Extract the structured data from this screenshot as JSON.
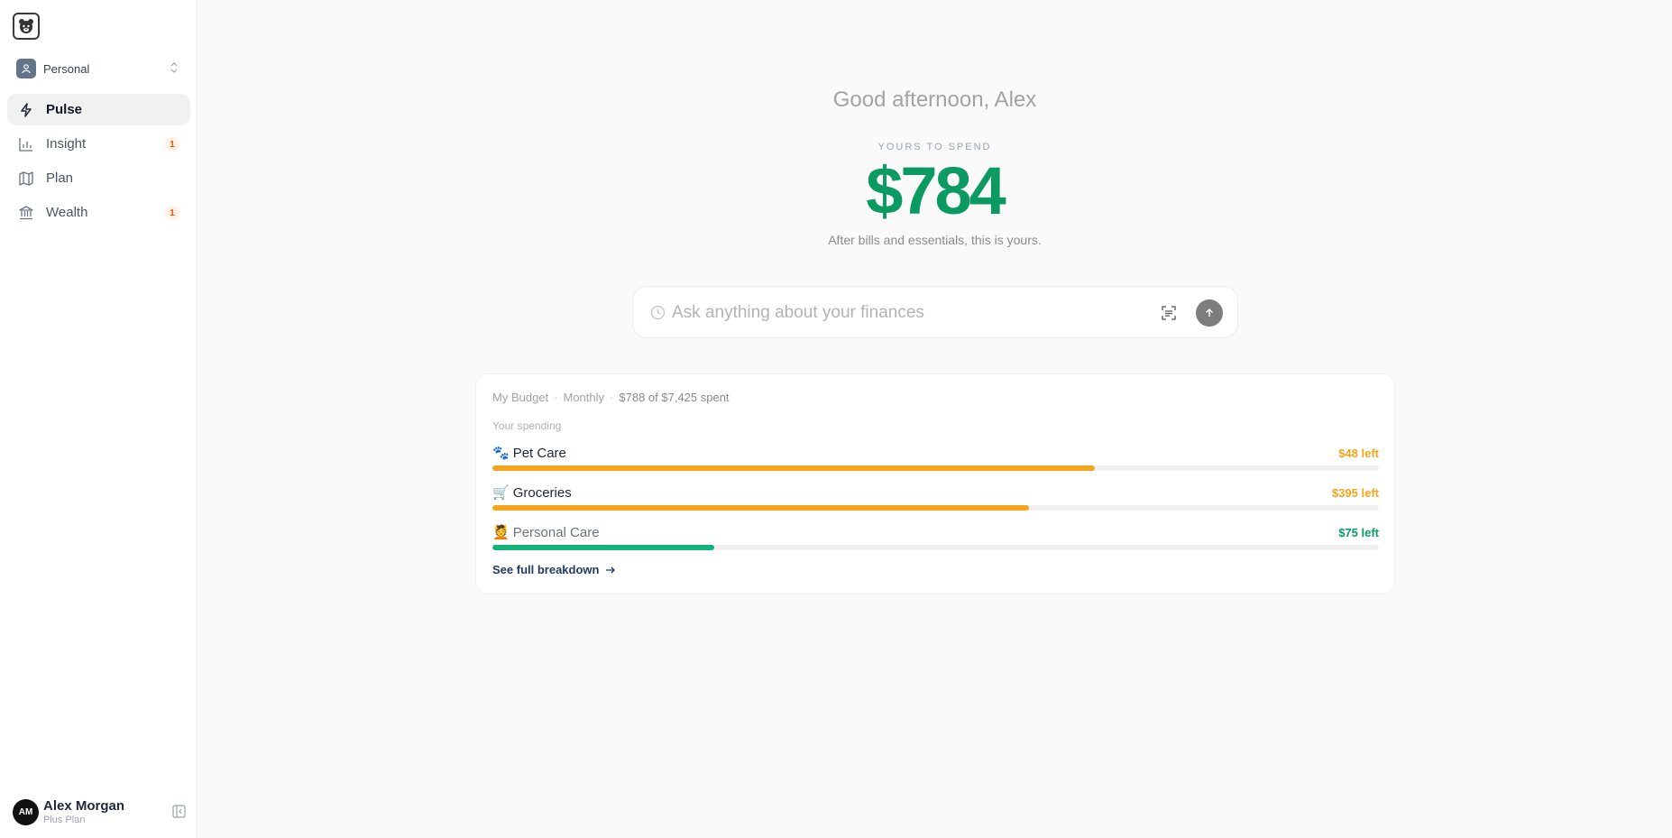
{
  "sidebar": {
    "workspace": {
      "label": "Personal"
    },
    "items": [
      {
        "label": "Pulse",
        "active": true,
        "icon": "bolt-icon"
      },
      {
        "label": "Insight",
        "badge": "1",
        "icon": "bar-chart-icon"
      },
      {
        "label": "Plan",
        "icon": "map-icon"
      },
      {
        "label": "Wealth",
        "badge": "1",
        "icon": "bank-icon"
      }
    ],
    "user": {
      "initials": "AM",
      "name": "Alex Morgan",
      "plan": "Plus Plan"
    }
  },
  "main": {
    "greeting": "Good afternoon, Alex",
    "spend_label": "YOURS TO SPEND",
    "spend_amount": "$784",
    "spend_sub": "After bills and essentials, this is yours.",
    "ask_placeholder": "Ask anything about your finances"
  },
  "budget": {
    "name": "My Budget",
    "period": "Monthly",
    "spent_summary": "$788 of $7,425 spent",
    "section_label": "Your spending",
    "categories": [
      {
        "emoji": "🐾",
        "name": "Pet Care",
        "left": "$48 left",
        "progress": 0.68,
        "color": "#f4a41d"
      },
      {
        "emoji": "🛒",
        "name": "Groceries",
        "left": "$395 left",
        "progress": 0.605,
        "color": "#f4a41d"
      },
      {
        "emoji": "💆",
        "name": "Personal Care",
        "left": "$75 left",
        "progress": 0.25,
        "color": "#12b47a"
      }
    ],
    "see_more": "See full breakdown"
  },
  "colors": {
    "accent_green": "#0c9a63",
    "warning_orange": "#f4a41d"
  }
}
